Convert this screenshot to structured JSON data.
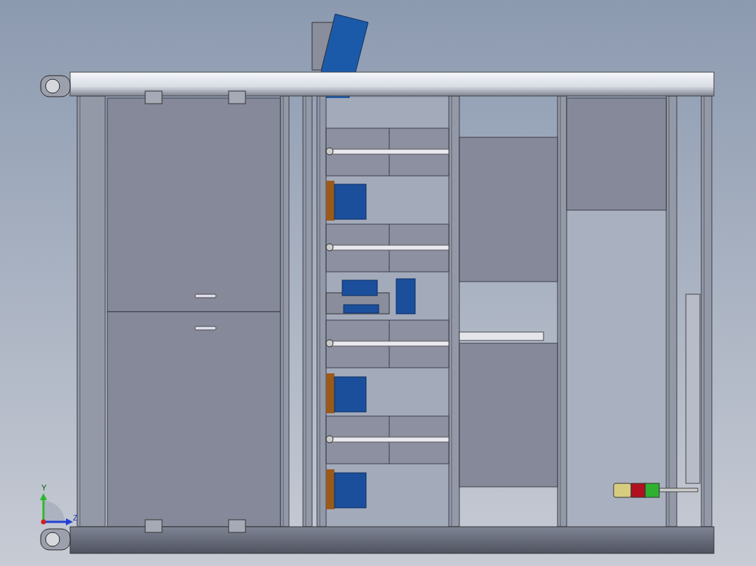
{
  "viewport": {
    "triad": {
      "axes": [
        {
          "label": "Y",
          "kind": "up",
          "color": "#2db82d"
        },
        {
          "label": "Z",
          "kind": "right",
          "color": "#1f3fd6"
        }
      ]
    }
  }
}
